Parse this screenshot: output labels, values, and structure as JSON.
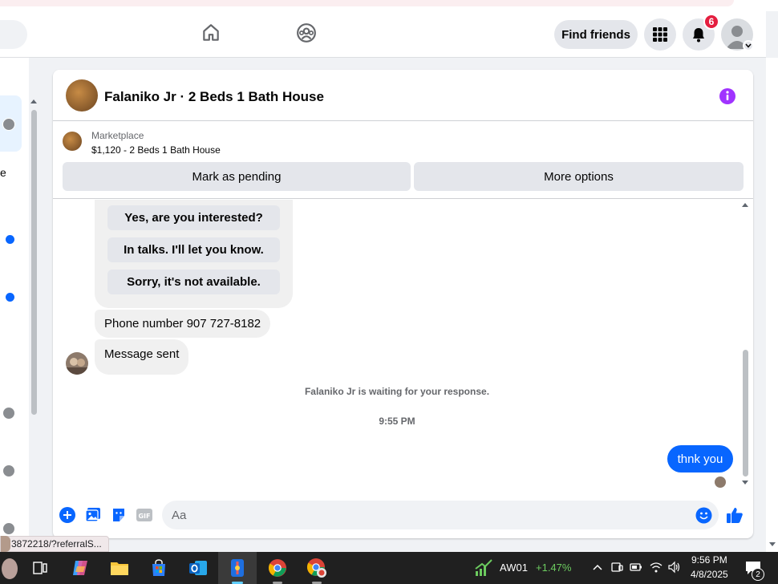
{
  "navbar": {
    "find_friends": "Find friends",
    "notification_count": "6",
    "icons": [
      "home-icon",
      "groups-icon",
      "menu-grid-icon",
      "bell-icon",
      "profile-avatar"
    ]
  },
  "chat": {
    "title": "Falaniko Jr · 2 Beds 1 Bath House",
    "marketplace": {
      "label": "Marketplace",
      "listing": "$1,120 - 2 Beds 1 Bath House",
      "mark_pending": "Mark as pending",
      "more_options": "More options"
    },
    "quick_replies": [
      "Yes, are you interested?",
      "In talks. I'll let you know.",
      "Sorry, it's not available."
    ],
    "messages": [
      {
        "from": "them",
        "text": "Phone number 907 727-8182"
      },
      {
        "from": "them",
        "text": "Message sent"
      },
      {
        "from": "me",
        "text": "thnk you"
      }
    ],
    "waiting_text": "Falaniko Jr is waiting for your response.",
    "timestamp": "9:55 PM",
    "composer_placeholder": "Aa",
    "composer_icons": [
      "plus-icon",
      "photo-icon",
      "sticker-icon",
      "gif-icon",
      "emoji-icon",
      "like-icon"
    ]
  },
  "left_panel": {
    "partial_text": "e"
  },
  "status_url": "3872218/?referralS...",
  "taskbar": {
    "stock_name": "AW01",
    "stock_change": "+1.47%",
    "time": "9:56 PM",
    "date": "4/8/2025",
    "notification_count": "2"
  },
  "colors": {
    "accent": "#0866ff",
    "badge": "#e41e3f",
    "info": "#a033ff",
    "stock_up": "#6ccb5f"
  }
}
